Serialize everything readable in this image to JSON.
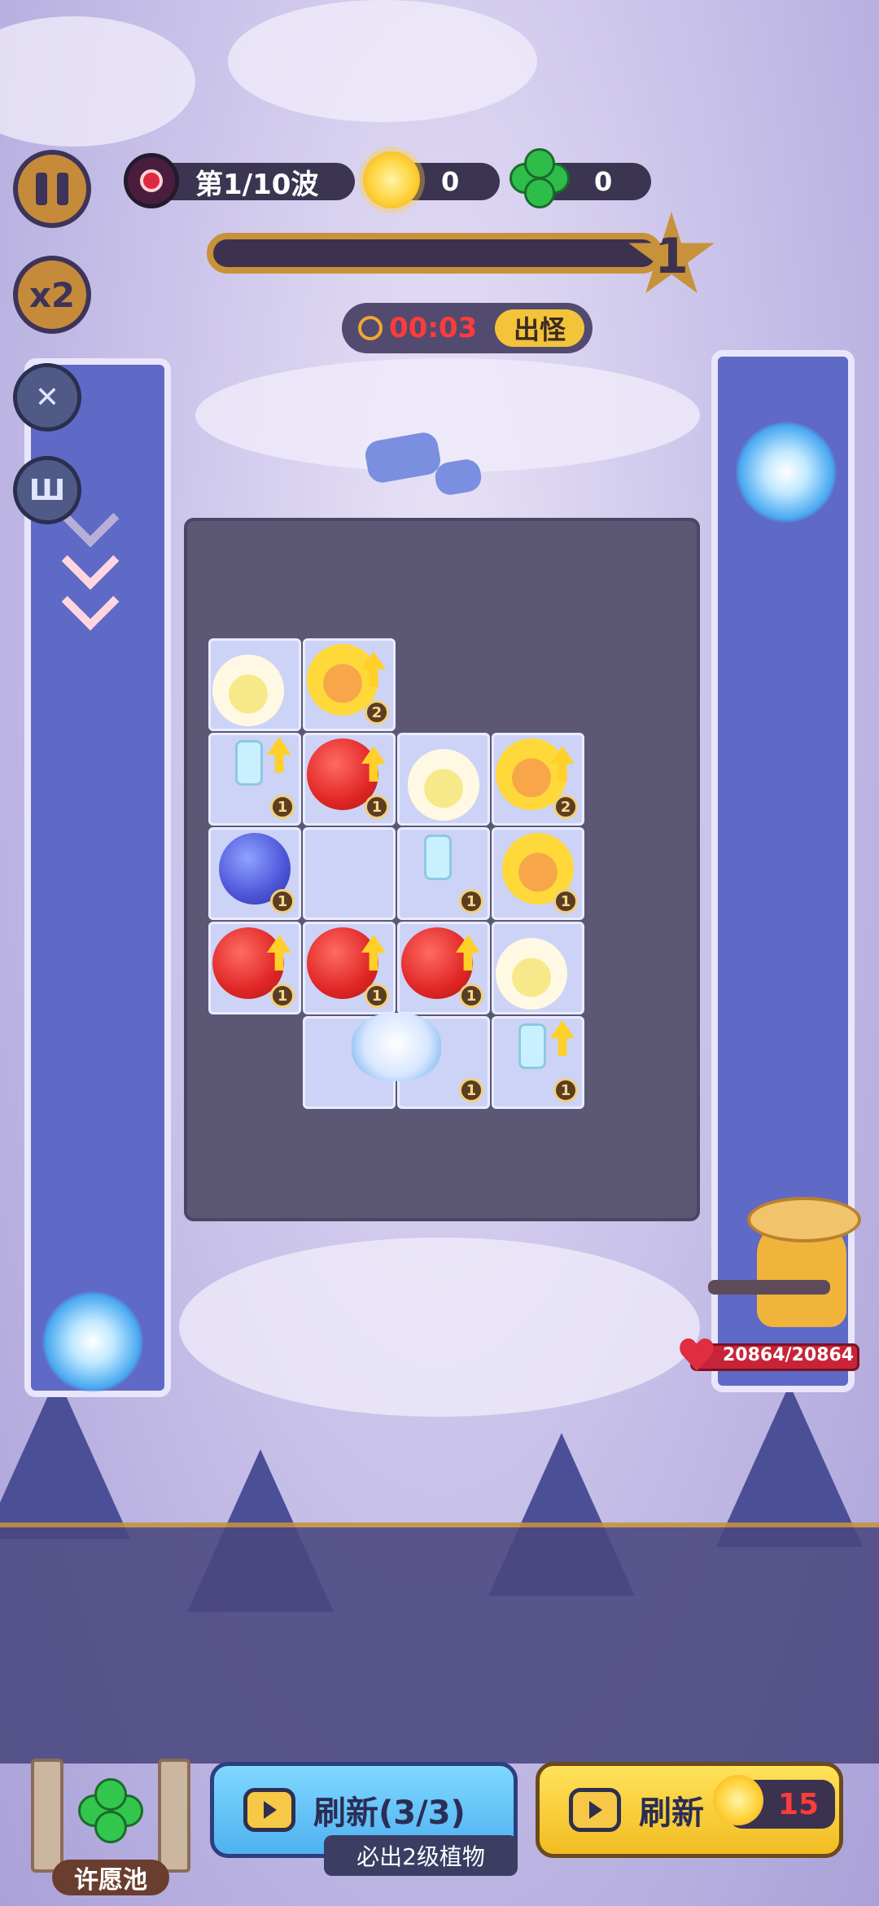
{
  "hud": {
    "wave_label": "第1/10波",
    "sun_count": "0",
    "clover_count": "0",
    "level": "1",
    "timer": "00:03",
    "spawn_button": "出怪",
    "speed_label": "x2"
  },
  "hero": {
    "hp_text": "20864/20864"
  },
  "bottom": {
    "wish_pool_label": "许愿池",
    "refresh_free_label": "刷新(3/3)",
    "refresh_free_sub": "必出2级植物",
    "refresh_paid_label": "刷新",
    "refresh_paid_cost": "15"
  },
  "board": {
    "plants": [
      {
        "type": "flower-white",
        "level": "1",
        "upgradable": true
      },
      {
        "type": "flower-yellow",
        "level": "2",
        "upgradable": true
      },
      {
        "type": "tomato",
        "level": "1",
        "upgradable": true
      },
      {
        "type": "flower-white",
        "level": "1",
        "upgradable": false
      },
      {
        "type": "flower-yellow",
        "level": "2",
        "upgradable": true
      },
      {
        "type": "blueberry",
        "level": "1",
        "upgradable": false
      },
      {
        "type": "flower-yellow",
        "level": "1",
        "upgradable": false
      },
      {
        "type": "tomato",
        "level": "1",
        "upgradable": true
      },
      {
        "type": "tomato",
        "level": "1",
        "upgradable": true
      },
      {
        "type": "tomato",
        "level": "1",
        "upgradable": true
      },
      {
        "type": "flower-white",
        "level": "1",
        "upgradable": true
      },
      {
        "type": "lotus",
        "level": "1",
        "upgradable": false
      }
    ]
  },
  "icons": {
    "pause": "pause-icon",
    "speed": "speed-x2-icon",
    "sun": "sun-icon",
    "clover": "clover-icon",
    "demon": "demon-eye-icon",
    "clock": "clock-icon",
    "tv": "video-ad-icon",
    "heart": "heart-icon"
  },
  "colors": {
    "accent_gold": "#c8923a",
    "timer_red": "#ff3b3b",
    "lane_blue": "#5f69c6",
    "board_dark": "#5b5775"
  }
}
